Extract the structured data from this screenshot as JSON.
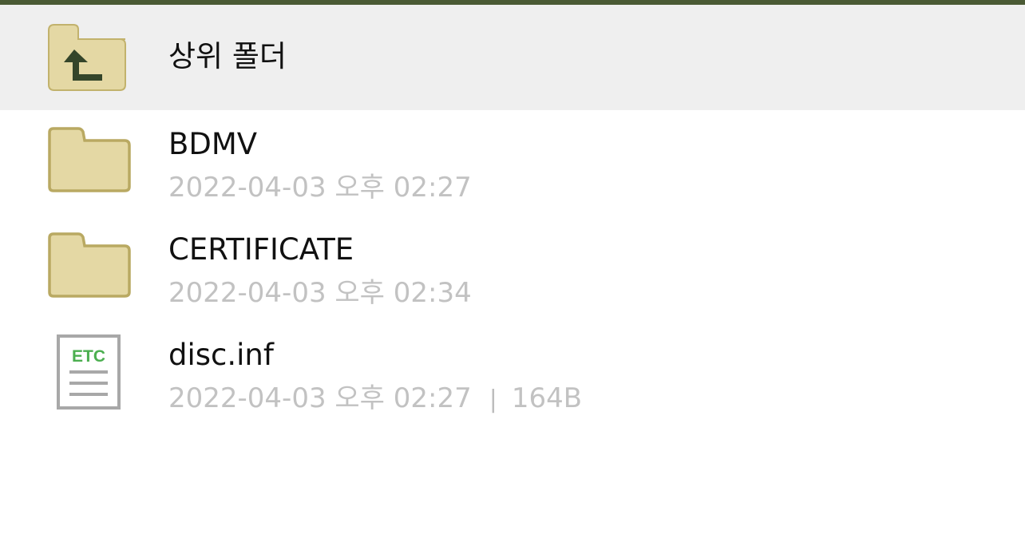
{
  "colors": {
    "top_bar": "#4a5a34",
    "parent_row_bg": "#efefef",
    "folder_fill": "#e4d8a4",
    "folder_stroke": "#b9a962",
    "arrow": "#34452a",
    "etc_green": "#4caf50",
    "meta_text": "#c2c2c2"
  },
  "parent": {
    "label": "상위 폴더",
    "icon": "folder-up-icon"
  },
  "files": [
    {
      "name": "BDMV",
      "date": "2022-04-03 오후 02:27",
      "size": "",
      "icon": "folder-icon"
    },
    {
      "name": "CERTIFICATE",
      "date": "2022-04-03 오후 02:34",
      "size": "",
      "icon": "folder-icon"
    },
    {
      "name": "disc.inf",
      "date": "2022-04-03 오후 02:27",
      "separator": "|",
      "size": "164B",
      "icon": "etc-file-icon",
      "icon_text": "ETC"
    }
  ]
}
